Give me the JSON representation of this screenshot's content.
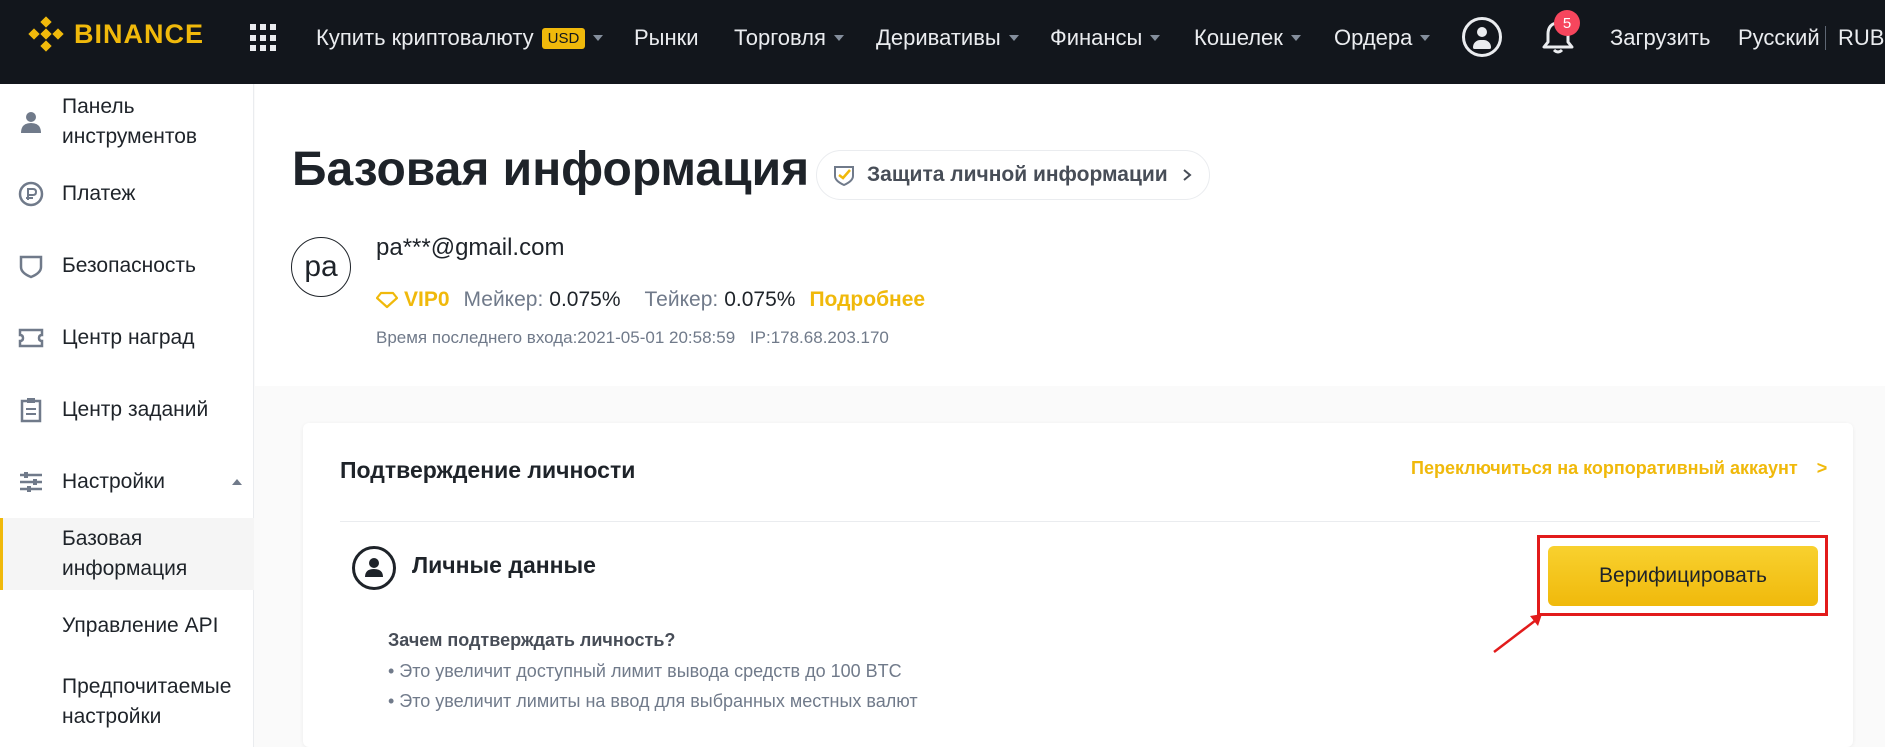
{
  "brand": {
    "name": "BINANCE",
    "accent": "#f0b90b",
    "nav_bg": "#12161c"
  },
  "topnav": {
    "buy_crypto": "Купить криптовалюту",
    "usd_badge": "USD",
    "markets": "Рынки",
    "trade": "Торговля",
    "derivatives": "Деривативы",
    "finance": "Финансы",
    "wallet": "Кошелек",
    "orders": "Ордера",
    "notifications_count": "5",
    "download": "Загрузить",
    "language": "Русский",
    "currency": "RUB",
    "icons": [
      "apps-grid-icon",
      "user-icon",
      "bell-icon"
    ]
  },
  "sidebar": {
    "items": [
      {
        "label": "Панель инструментов",
        "icon": "person-icon"
      },
      {
        "label": "Платеж",
        "icon": "payment-icon"
      },
      {
        "label": "Безопасность",
        "icon": "shield-icon"
      },
      {
        "label": "Центр наград",
        "icon": "ticket-icon"
      },
      {
        "label": "Центр заданий",
        "icon": "clipboard-icon"
      },
      {
        "label": "Настройки",
        "icon": "sliders-icon"
      }
    ],
    "sub_items": [
      "Базовая информация",
      "Управление API",
      "Предпочитаемые настройки"
    ]
  },
  "header": {
    "title": "Базовая информация",
    "privacy_link": "Защита личной информации",
    "avatar_initials": "pa",
    "email": "pa***@gmail.com",
    "vip_level": "VIP0",
    "maker_label": "Мейкер:",
    "maker_fee": "0.075%",
    "taker_label": "Тейкер:",
    "taker_fee": "0.075%",
    "more_link": "Подробнее",
    "last_login": "Время последнего входа:2021-05-01 20:58:59",
    "ip": "IP:178.68.203.170"
  },
  "card": {
    "title": "Подтверждение личности",
    "corp_link": "Переключиться на корпоративный аккаунт",
    "section_title": "Личные данные",
    "verify_button": "Верифицировать",
    "why_title": "Зачем подтверждать личность?",
    "why_items": [
      "• Это увеличит доступный лимит вывода средств до 100 BTC",
      "• Это увеличит лимиты на ввод для выбранных местных валют"
    ]
  }
}
